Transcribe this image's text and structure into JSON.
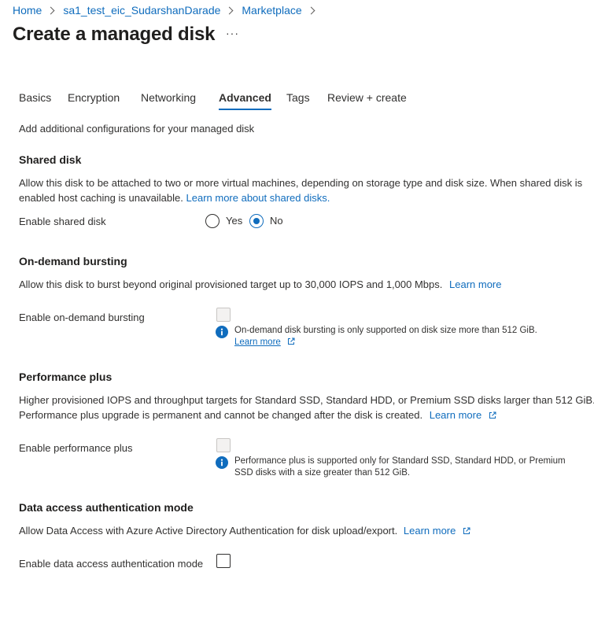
{
  "breadcrumb": {
    "items": [
      "Home",
      "sa1_test_eic_SudarshanDarade",
      "Marketplace"
    ]
  },
  "header": {
    "title": "Create a managed disk",
    "more_label": "···"
  },
  "tabs": [
    "Basics",
    "Encryption",
    "Networking",
    "Advanced",
    "Tags",
    "Review + create"
  ],
  "active_tab": "Advanced",
  "intro": "Add additional configurations for your managed disk",
  "shared_disk": {
    "title": "Shared disk",
    "desc_line1": "Allow this disk to be attached to two or more virtual machines, depending on storage type and disk size. When shared disk is",
    "desc_line2": "enabled host caching is unavailable.",
    "link": "Learn more about shared disks.",
    "field_label": "Enable shared disk",
    "options": [
      "Yes",
      "No"
    ],
    "selected": "No"
  },
  "bursting": {
    "title": "On-demand bursting",
    "desc": "Allow this disk to burst beyond original provisioned target up to 30,000 IOPS and 1,000 Mbps.",
    "link": "Learn more",
    "field_label": "Enable on-demand bursting",
    "info_text": "On-demand disk bursting is only supported on disk size more than 512 GiB.",
    "info_link": "Learn more"
  },
  "perf_plus": {
    "title": "Performance plus",
    "desc_line1": "Higher provisioned IOPS and throughput targets for Standard SSD, Standard HDD, or Premium SSD disks larger than 512 GiB.",
    "desc_line2": "Performance plus upgrade is permanent and cannot be changed after the disk is created.",
    "link": "Learn more",
    "field_label": "Enable performance plus",
    "info_line1": "Performance plus is supported only for Standard SSD, Standard HDD, or Premium",
    "info_line2": "SSD disks with a size greater than 512 GiB."
  },
  "data_access": {
    "title": "Data access authentication mode",
    "desc": "Allow Data Access with Azure Active Directory Authentication for disk upload/export.",
    "link": "Learn more",
    "field_label": "Enable data access authentication mode"
  },
  "colors": {
    "accent": "#0f6cbd",
    "text": "#323130",
    "disabled": "#c8c6c4"
  },
  "icons": [
    "chevron-right-icon",
    "info-icon",
    "external-link-icon"
  ]
}
